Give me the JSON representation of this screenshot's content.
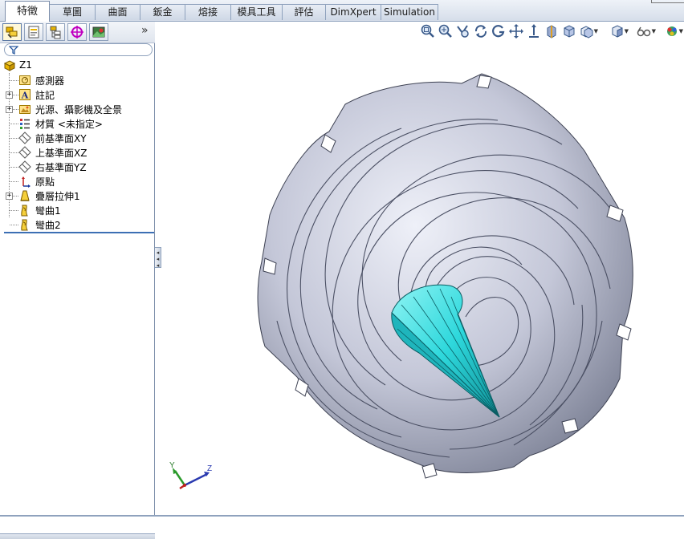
{
  "tabs": [
    {
      "id": "features",
      "label": "特徵",
      "active": true
    },
    {
      "id": "sketch",
      "label": "草圖"
    },
    {
      "id": "surfaces",
      "label": "曲面"
    },
    {
      "id": "sheetmetal",
      "label": "鈑金"
    },
    {
      "id": "weldments",
      "label": "熔接"
    },
    {
      "id": "moldtools",
      "label": "模具工具"
    },
    {
      "id": "evaluate",
      "label": "評估"
    },
    {
      "id": "dimxpert",
      "label": "DimXpert"
    },
    {
      "id": "simulation",
      "label": "Simulation"
    }
  ],
  "feature_tree": {
    "root": "Z1",
    "items": [
      {
        "label": "感測器",
        "icon": "sensor-icon",
        "expandable": false
      },
      {
        "label": "註記",
        "icon": "annotation-icon",
        "expandable": true
      },
      {
        "label": "光源、攝影機及全景",
        "icon": "lights-cameras-icon",
        "expandable": true
      },
      {
        "label": "材質 <未指定>",
        "icon": "material-icon",
        "expandable": false
      },
      {
        "label": "前基準面XY",
        "icon": "plane-icon",
        "expandable": false
      },
      {
        "label": "上基準面XZ",
        "icon": "plane-icon",
        "expandable": false
      },
      {
        "label": "右基準面YZ",
        "icon": "plane-icon",
        "expandable": false
      },
      {
        "label": "原點",
        "icon": "origin-icon",
        "expandable": false
      },
      {
        "label": "疊層拉伸1",
        "icon": "loft-icon",
        "expandable": true
      },
      {
        "label": "彎曲1",
        "icon": "flex-icon",
        "expandable": false
      },
      {
        "label": "彎曲2",
        "icon": "flex-icon",
        "expandable": false
      }
    ]
  },
  "fm_tabs": [
    "feature-manager-icon",
    "property-manager-icon",
    "configuration-manager-icon",
    "dimxpert-manager-icon",
    "display-manager-icon"
  ],
  "fm_more": "»",
  "triad": {
    "y": "Y",
    "z": "Z"
  },
  "colors": {
    "tab_border": "#8fa2bd",
    "model_gray": "#b6b9c9",
    "model_cyan": "#3ee6e6",
    "rollback_bar": "#3c6fb4"
  }
}
